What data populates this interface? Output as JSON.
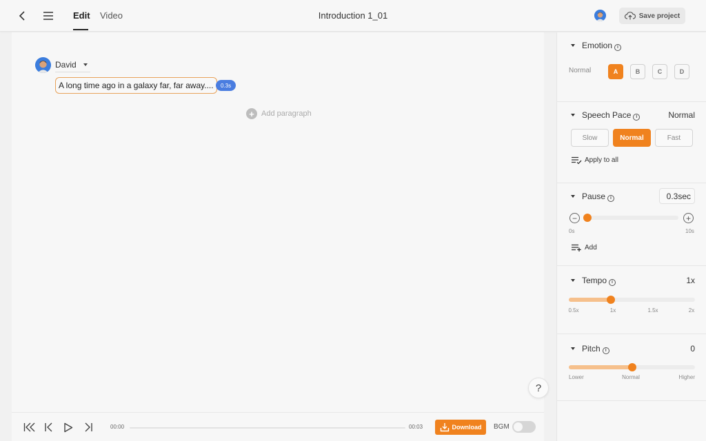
{
  "header": {
    "tabs": [
      {
        "label": "Edit",
        "active": true
      },
      {
        "label": "Video",
        "active": false
      }
    ],
    "title": "Introduction 1_01",
    "save_label": "Save project"
  },
  "editor": {
    "speaker": "David",
    "paragraph_text": "A long time ago in a galaxy far, far away....",
    "pause_badge": "0.3s",
    "add_paragraph_label": "Add paragraph",
    "help_label": "?"
  },
  "player": {
    "current_time": "00:00",
    "total_time": "00:03",
    "progress": 0,
    "download_label": "Download",
    "bgm_label": "BGM",
    "bgm_enabled": false
  },
  "panel": {
    "emotion": {
      "title": "Emotion",
      "label": "Normal",
      "options": [
        "A",
        "B",
        "C",
        "D"
      ],
      "selected": "A"
    },
    "speech_pace": {
      "title": "Speech Pace",
      "value": "Normal",
      "options": [
        "Slow",
        "Normal",
        "Fast"
      ],
      "selected": "Normal",
      "apply_all_label": "Apply to all"
    },
    "pause": {
      "title": "Pause",
      "value": "0.3sec",
      "min_label": "0s",
      "max_label": "10s",
      "level": 0.03,
      "add_label": "Add"
    },
    "tempo": {
      "title": "Tempo",
      "value": "1x",
      "ticks": [
        "0.5x",
        "1x",
        "1.5x",
        "2x"
      ],
      "level": 0.333
    },
    "pitch": {
      "title": "Pitch",
      "value": "0",
      "ticks": [
        "Lower",
        "Normal",
        "Higher"
      ],
      "level": 0.5
    }
  },
  "colors": {
    "accent": "#f0821e",
    "accent_light": "#f6c08c",
    "badge_blue": "#4a7de0"
  }
}
